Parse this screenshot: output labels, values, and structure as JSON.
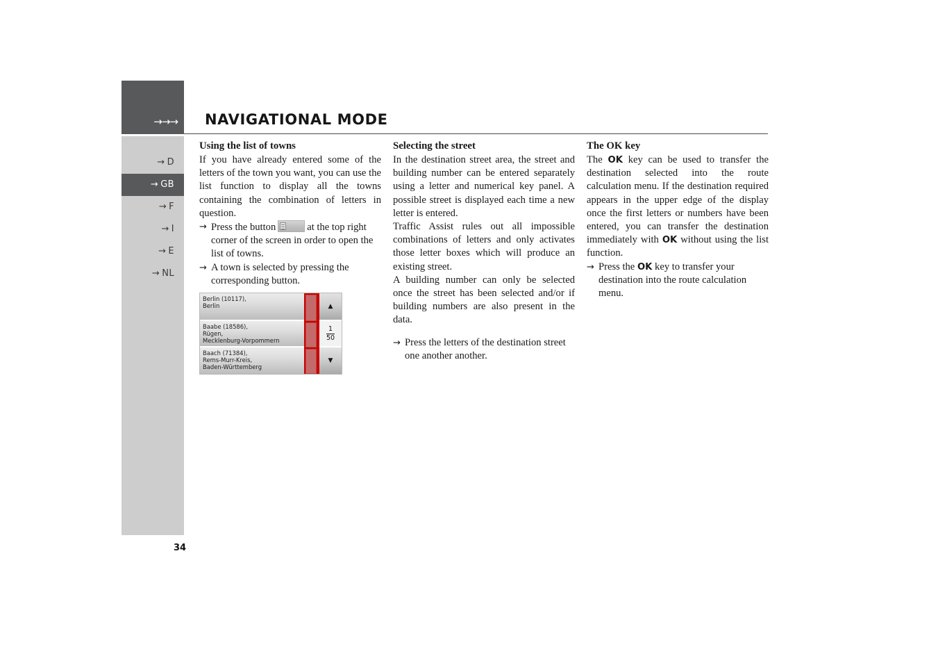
{
  "page": {
    "chapter_title": "NAVIGATIONAL MODE",
    "header_arrows": "→→→",
    "folio": "34"
  },
  "sidebar": {
    "items": [
      {
        "arrow": "→",
        "label": "D",
        "active": false
      },
      {
        "arrow": "→",
        "label": "GB",
        "active": true
      },
      {
        "arrow": "→",
        "label": "F",
        "active": false
      },
      {
        "arrow": "→",
        "label": "I",
        "active": false
      },
      {
        "arrow": "→",
        "label": "E",
        "active": false
      },
      {
        "arrow": "→",
        "label": "NL",
        "active": false
      }
    ]
  },
  "columns": {
    "col1": {
      "heading": "Using the list of towns",
      "para1": "If you have already entered some of the letters of the town you want, you can use the list function to display all the towns containing the combination of letters in question.",
      "bullet1_arrow": "→",
      "bullet1_pre": "Press the button",
      "bullet1_post": "at the top right corner of the screen in order to open the list of towns.",
      "bullet2_arrow": "→",
      "bullet2": "A town is selected by pressing the corresponding button."
    },
    "col2": {
      "heading": "Selecting the street",
      "para1": "In the destination street area, the street and building number can be entered separately using a letter and numerical key panel. A possible street is displayed each time a new letter is entered.",
      "para2": "Traffic Assist rules out all impossible combinations of letters and only activates those letter boxes which will produce an existing street.",
      "para3": "A building number can only be selected once the street has been selected and/or if building numbers are also present in the data.",
      "bullet1_arrow": "→",
      "bullet1": "Press the letters of the destination street one another another."
    },
    "col3": {
      "heading": "The OK key",
      "para1_a": "The",
      "para1_ok": "OK",
      "para1_b": "key can be used to transfer the destination selected into the route calculation menu. If the destination required appears in the upper edge of the display once the first letters or numbers have been entered, you can transfer the destination immediately with",
      "para1_ok2": "OK",
      "para1_c": "without using the list function.",
      "bullet1_arrow": "→",
      "bullet1_a": "Press the",
      "bullet1_ok": "OK",
      "bullet1_b": "key to transfer your destination into the route calculation menu."
    }
  },
  "figure": {
    "name": "town-list-screen",
    "rows": [
      {
        "lines": [
          "Berlin (10117),",
          "Berlin"
        ]
      },
      {
        "lines": [
          "Baabe (18586),",
          "Rügen,",
          "Mecklenburg-Vorpommern"
        ]
      },
      {
        "lines": [
          "Baach (71384),",
          "Rems-Murr-Kreis,",
          "Baden-Württemberg"
        ]
      }
    ],
    "scroll_up": "▲",
    "scroll_down": "▼",
    "page_numerator": "1",
    "page_denominator": "50"
  },
  "colors": {
    "rail_active": "#58595a",
    "rail_bg": "#cdcdcd",
    "scrollbar_red": "#cc0000",
    "scroll_thumb_red": "#c56a6a"
  }
}
